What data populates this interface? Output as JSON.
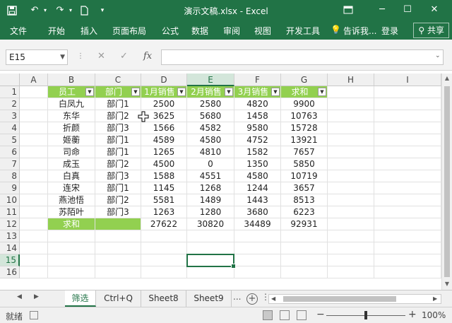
{
  "window": {
    "title": "演示文稿.xlsx - Excel"
  },
  "quick_access": {
    "save_icon": "save-icon",
    "undo_icon": "undo-icon",
    "redo_icon": "redo-icon",
    "new_icon": "new-file-icon",
    "customize_icon": "customize-icon"
  },
  "ribbon": {
    "tabs": [
      "文件",
      "开始",
      "插入",
      "页面布局",
      "公式",
      "数据",
      "审阅",
      "视图",
      "开发工具"
    ],
    "tell_me": "告诉我...",
    "login": "登录",
    "share": "共享"
  },
  "formula_bar": {
    "name_box": "E15",
    "fx": "fx",
    "formula": ""
  },
  "grid": {
    "col_headers": [
      "A",
      "B",
      "C",
      "D",
      "E",
      "F",
      "G",
      "H",
      "I"
    ],
    "row_headers": [
      "1",
      "2",
      "3",
      "4",
      "5",
      "6",
      "7",
      "8",
      "9",
      "10",
      "11",
      "12",
      "13",
      "14",
      "15",
      "16"
    ],
    "selected_col": "E",
    "selected_row": "15",
    "table_headers": [
      "员工",
      "部门",
      "1月销售",
      "2月销售",
      "3月销售",
      "求和"
    ],
    "rows": [
      [
        "白凤九",
        "部门1",
        "2500",
        "2580",
        "4820",
        "9900"
      ],
      [
        "东华",
        "部门2",
        "3625",
        "5680",
        "1458",
        "10763"
      ],
      [
        "折颜",
        "部门3",
        "1566",
        "4582",
        "9580",
        "15728"
      ],
      [
        "姬蘅",
        "部门1",
        "4589",
        "4580",
        "4752",
        "13921"
      ],
      [
        "司命",
        "部门1",
        "1265",
        "4810",
        "1582",
        "7657"
      ],
      [
        "成玉",
        "部门2",
        "4500",
        "0",
        "1350",
        "5850"
      ],
      [
        "白真",
        "部门3",
        "1588",
        "4551",
        "4580",
        "10719"
      ],
      [
        "连宋",
        "部门1",
        "1145",
        "1268",
        "1244",
        "3657"
      ],
      [
        "燕池悟",
        "部门2",
        "5581",
        "1489",
        "1443",
        "8513"
      ],
      [
        "苏陌叶",
        "部门3",
        "1263",
        "1280",
        "3680",
        "6223"
      ]
    ],
    "sum_row": [
      "求和",
      "",
      "27622",
      "30820",
      "34489",
      "92931"
    ]
  },
  "sheets": {
    "tabs": [
      "筛选",
      "Ctrl+Q",
      "Sheet8",
      "Sheet9"
    ],
    "active": 0,
    "more": "...",
    "add": "+"
  },
  "status": {
    "ready": "就绪",
    "zoom": "100%",
    "zoom_fraction": 0.5
  },
  "colors": {
    "accent": "#217346",
    "header_fill": "#92d050"
  }
}
